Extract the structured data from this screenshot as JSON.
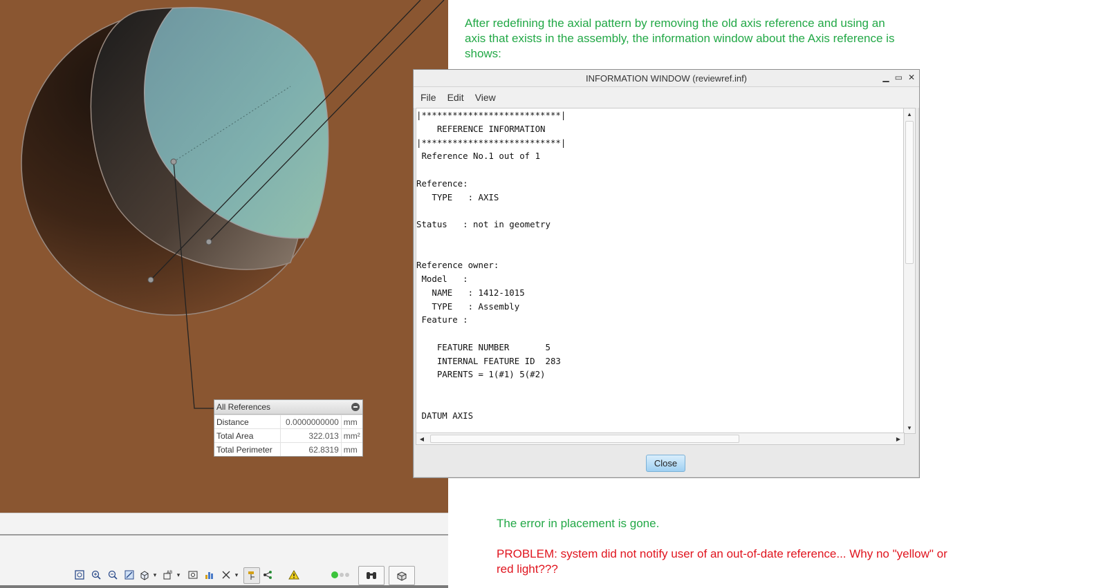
{
  "measure_panel": {
    "title": "All References",
    "rows": [
      {
        "label": "Distance",
        "value": "0.0000000000",
        "unit": "mm"
      },
      {
        "label": "Total Area",
        "value": "322.013",
        "unit": "mm²"
      },
      {
        "label": "Total Perimeter",
        "value": "62.8319",
        "unit": "mm"
      }
    ]
  },
  "notes": {
    "top": [
      "After redefining the axial pattern by removing the old axis reference and using an",
      "axis that exists in the assembly, the information window about the Axis reference is",
      "shows:"
    ],
    "error_gone": "The error in placement is gone.",
    "problem": [
      "PROBLEM: system did not notify user of an out-of-date reference...  Why no \"yellow\" or",
      "red light???"
    ]
  },
  "info_window": {
    "title": "INFORMATION  WINDOW (reviewref.inf)",
    "menu": [
      "File",
      "Edit",
      "View"
    ],
    "lines": [
      "|***************************|",
      "    REFERENCE INFORMATION",
      "|***************************|",
      " Reference No.1 out of 1",
      "",
      "Reference:",
      "   TYPE   : AXIS",
      "",
      "Status   : not in geometry",
      "",
      "",
      "Reference owner:",
      " Model   :",
      "   NAME   : 1412-1015",
      "   TYPE   : Assembly",
      " Feature :",
      "",
      "    FEATURE NUMBER       5",
      "    INTERNAL FEATURE ID  283",
      "    PARENTS = 1(#1) 5(#2)",
      "",
      "",
      " DATUM AXIS"
    ],
    "close_label": "Close"
  },
  "colors": {
    "viewport_bg": "#8a5631",
    "note_green": "#22a846",
    "note_red": "#e0141e"
  },
  "toolbar": {
    "icons": [
      "zoom-fit-icon",
      "zoom-in-icon",
      "zoom-out-icon",
      "repaint-icon",
      "view-orient-icon",
      "annotation-display-icon",
      "saved-views-icon",
      "display-style-icon",
      "datum-display-icon",
      "spin-center-icon",
      "model-tree-icon",
      "warning-icon",
      "status-light-icon",
      "find-icon",
      "view-manager-icon"
    ]
  }
}
